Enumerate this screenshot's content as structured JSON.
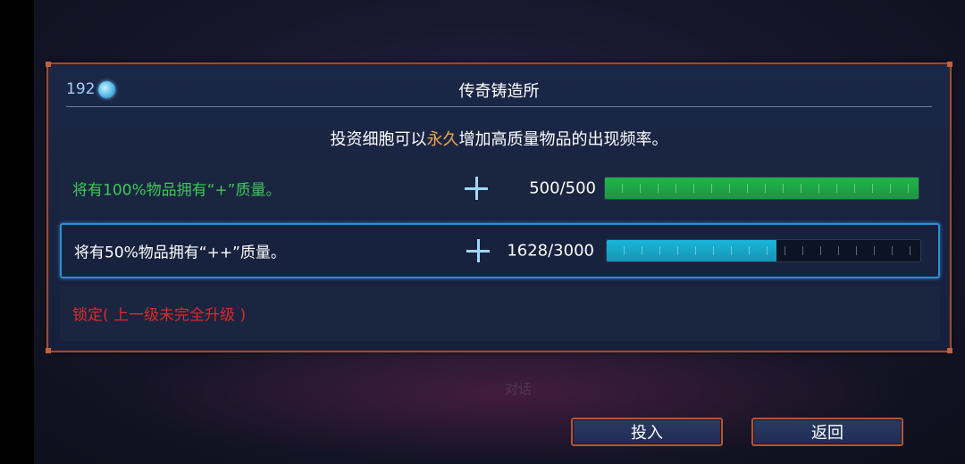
{
  "background": {
    "hint_text": "对话"
  },
  "header": {
    "cells_count": "192",
    "cells_icon": "cell-icon",
    "title": "传奇铸造所",
    "subtitle_before": "投资细胞可以",
    "subtitle_highlight": "永久",
    "subtitle_after": "增加高质量物品的出现频率。"
  },
  "rows": [
    {
      "text": "将有100%物品拥有“+”质量。",
      "count": "500/500",
      "progress": 1.0,
      "text_color": "#3ec65a",
      "bar_color": "#1fb54a",
      "selected": false,
      "plus_icon": "plus-icon"
    },
    {
      "text": "将有50%物品拥有“++”质量。",
      "count": "1628/3000",
      "progress": 0.5427,
      "text_color": "#ffffff",
      "bar_color": "#19b5d8",
      "selected": true,
      "plus_icon": "plus-icon"
    },
    {
      "text": "锁定( 上一级未完全升级 )",
      "text_color": "#e02828",
      "selected": false
    }
  ],
  "buttons": {
    "invest": "投入",
    "back": "返回"
  }
}
